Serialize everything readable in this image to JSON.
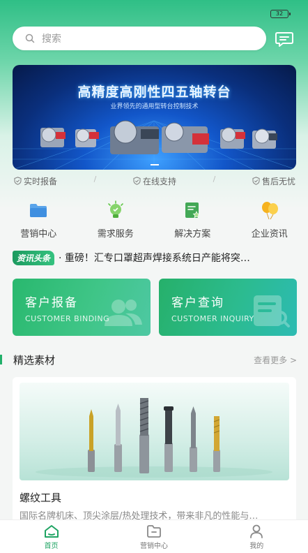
{
  "status": {
    "battery": "32"
  },
  "search": {
    "placeholder": "搜索"
  },
  "banner": {
    "title": "高精度高刚性四五轴转台",
    "subtitle": "业界领先的通用型转台控制技术"
  },
  "guarantees": [
    "实时报备",
    "在线支持",
    "售后无忧"
  ],
  "quick_actions": [
    {
      "label": "营销中心",
      "icon": "folder-icon"
    },
    {
      "label": "需求服务",
      "icon": "lightbulb-icon"
    },
    {
      "label": "解决方案",
      "icon": "document-star-icon"
    },
    {
      "label": "企业资讯",
      "icon": "balloons-icon"
    }
  ],
  "news": {
    "badge": "资讯头条",
    "text": "· 重磅！汇专口罩超声焊接系统日产能将突…"
  },
  "cards": [
    {
      "title": "客户报备",
      "subtitle": "CUSTOMER BINDING"
    },
    {
      "title": "客户查询",
      "subtitle": "CUSTOMER INQUIRY"
    }
  ],
  "section": {
    "title": "精选素材",
    "more": "查看更多 >"
  },
  "feature": {
    "title": "螺纹工具",
    "description": "国际名牌机床、顶尖涂层/热处理技术，带来非凡的性能与…"
  },
  "tabbar": [
    {
      "label": "首页",
      "active": true
    },
    {
      "label": "营销中心",
      "active": false
    },
    {
      "label": "我的",
      "active": false
    }
  ],
  "colors": {
    "accent": "#1fa463",
    "banner": "#0a2f7c"
  }
}
